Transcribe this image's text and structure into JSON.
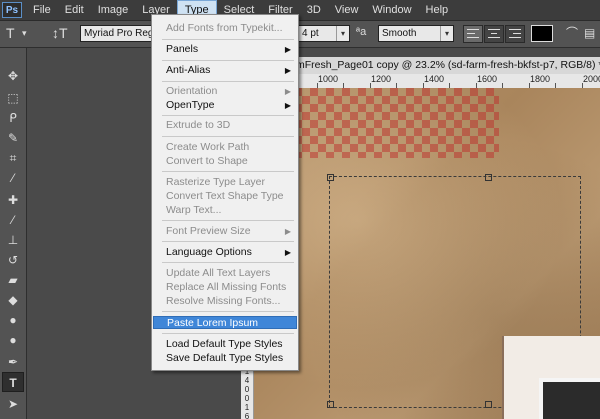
{
  "menubar": {
    "logo": "Ps",
    "items": [
      "File",
      "Edit",
      "Image",
      "Layer",
      "Type",
      "Select",
      "Filter",
      "3D",
      "View",
      "Window",
      "Help"
    ],
    "active": "Type"
  },
  "options": {
    "font_family": "Myriad Pro Regular",
    "font_size": "4 pt",
    "aa_glyph": "ªa",
    "anti_alias": "Smooth"
  },
  "document": {
    "tab_title": "mFresh_Page01 copy @ 23.2% (sd-farm-fresh-bkfst-p7, RGB/8) *",
    "ruler_h": [
      "1000",
      "1200",
      "1400",
      "1600",
      "1800",
      "2000"
    ],
    "ruler_v": [
      "1",
      "4",
      "0",
      "0",
      "1",
      "6",
      "0"
    ]
  },
  "type_menu": {
    "items": [
      {
        "label": "Add Fonts from Typekit...",
        "enabled": false,
        "submenu": false
      },
      {
        "label": "Panels",
        "enabled": true,
        "submenu": true
      },
      {
        "label": "Anti-Alias",
        "enabled": true,
        "submenu": true
      },
      {
        "label": "Orientation",
        "enabled": false,
        "submenu": true
      },
      {
        "label": "OpenType",
        "enabled": true,
        "submenu": true
      },
      {
        "label": "Extrude to 3D",
        "enabled": false,
        "submenu": false
      },
      {
        "label": "Create Work Path",
        "enabled": false,
        "submenu": false
      },
      {
        "label": "Convert to Shape",
        "enabled": false,
        "submenu": false
      },
      {
        "label": "Rasterize Type Layer",
        "enabled": false,
        "submenu": false
      },
      {
        "label": "Convert Text Shape Type",
        "enabled": false,
        "submenu": false
      },
      {
        "label": "Warp Text...",
        "enabled": false,
        "submenu": false
      },
      {
        "label": "Font Preview Size",
        "enabled": false,
        "submenu": true
      },
      {
        "label": "Language Options",
        "enabled": true,
        "submenu": true
      },
      {
        "label": "Update All Text Layers",
        "enabled": false,
        "submenu": false
      },
      {
        "label": "Replace All Missing Fonts",
        "enabled": false,
        "submenu": false
      },
      {
        "label": "Resolve Missing Fonts...",
        "enabled": false,
        "submenu": false
      },
      {
        "label": "Paste Lorem Ipsum",
        "enabled": true,
        "submenu": false,
        "highlighted": true
      },
      {
        "label": "Load Default Type Styles",
        "enabled": true,
        "submenu": false
      },
      {
        "label": "Save Default Type Styles",
        "enabled": true,
        "submenu": false
      }
    ]
  },
  "tools": [
    "move-tool-icon",
    "marquee-tool-icon",
    "lasso-tool-icon",
    "quick-select-tool-icon",
    "crop-tool-icon",
    "eyedropper-tool-icon",
    "healing-brush-tool-icon",
    "brush-tool-icon",
    "clone-stamp-tool-icon",
    "history-brush-tool-icon",
    "eraser-tool-icon",
    "paint-bucket-tool-icon",
    "blur-tool-icon",
    "dodge-tool-icon",
    "pen-tool-icon",
    "type-tool-icon",
    "path-select-tool-icon"
  ]
}
